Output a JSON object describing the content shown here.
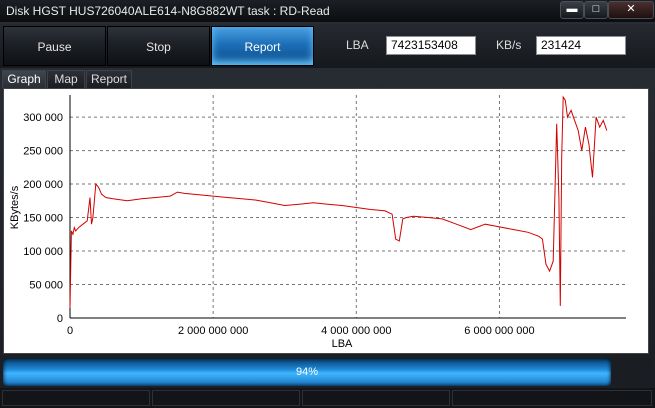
{
  "window": {
    "title": "Disk HGST HUS726040ALE614-N8G882WT   task : RD-Read",
    "minimize_icon": "minimize-icon",
    "maximize_icon": "maximize-icon",
    "close_icon": "close-icon"
  },
  "toolbar": {
    "pause_label": "Pause",
    "stop_label": "Stop",
    "report_label": "Report",
    "lba_label": "LBA",
    "lba_value": "7423153408",
    "kbs_label": "KB/s",
    "kbs_value": "231424"
  },
  "tabs": [
    {
      "label": "Graph",
      "active": true
    },
    {
      "label": "Map",
      "active": false
    },
    {
      "label": "Report",
      "active": false
    }
  ],
  "chart_data": {
    "type": "line",
    "xlabel": "LBA",
    "ylabel": "KBytes/s",
    "xlim": [
      0,
      7600000000
    ],
    "ylim": [
      0,
      330000
    ],
    "xticks": [
      0,
      2000000000,
      4000000000,
      6000000000
    ],
    "xtick_labels": [
      "0",
      "2 000 000 000",
      "4 000 000 000",
      "6 000 000 000"
    ],
    "yticks": [
      0,
      50000,
      100000,
      150000,
      200000,
      250000,
      300000
    ],
    "ytick_labels": [
      "0",
      "50 000",
      "100 000",
      "150 000",
      "200 000",
      "250 000",
      "300 000"
    ],
    "grid": true,
    "line_color": "#d40000",
    "series": [
      {
        "x": [
          0,
          20000000,
          40000000,
          60000000,
          80000000,
          120000000,
          180000000,
          240000000,
          280000000,
          300000000,
          320000000,
          360000000,
          400000000,
          440000000,
          500000000,
          600000000,
          800000000,
          1000000000,
          1200000000,
          1400000000,
          1500000000,
          1600000000,
          1800000000,
          2000000000,
          2200000000,
          2400000000,
          2600000000,
          2800000000,
          3000000000,
          3200000000,
          3400000000,
          3600000000,
          3800000000,
          4000000000,
          4200000000,
          4400000000,
          4500000000,
          4550000000,
          4600000000,
          4650000000,
          4700000000,
          4800000000,
          5000000000,
          5200000000,
          5400000000,
          5600000000,
          5800000000,
          6000000000,
          6200000000,
          6400000000,
          6550000000,
          6600000000,
          6650000000,
          6700000000,
          6750000000,
          6800000000,
          6830000000,
          6850000000,
          6870000000,
          6890000000,
          6920000000,
          6950000000,
          7000000000,
          7050000000,
          7100000000,
          7150000000,
          7200000000,
          7250000000,
          7300000000,
          7350000000,
          7400000000,
          7450000000,
          7500000000
        ],
        "y": [
          15000,
          130000,
          125000,
          135000,
          130000,
          135000,
          140000,
          145000,
          180000,
          140000,
          150000,
          200000,
          195000,
          185000,
          180000,
          178000,
          175000,
          178000,
          180000,
          182000,
          188000,
          186000,
          184000,
          182000,
          180000,
          178000,
          176000,
          172000,
          168000,
          170000,
          172000,
          170000,
          168000,
          165000,
          162000,
          160000,
          155000,
          118000,
          115000,
          148000,
          150000,
          152000,
          150000,
          148000,
          140000,
          132000,
          140000,
          136000,
          132000,
          128000,
          122000,
          118000,
          80000,
          70000,
          85000,
          290000,
          180000,
          18000,
          240000,
          330000,
          325000,
          300000,
          310000,
          295000,
          280000,
          250000,
          285000,
          260000,
          210000,
          300000,
          285000,
          295000,
          280000
        ]
      }
    ]
  },
  "progress": {
    "value": 0.94,
    "label": "94%"
  }
}
